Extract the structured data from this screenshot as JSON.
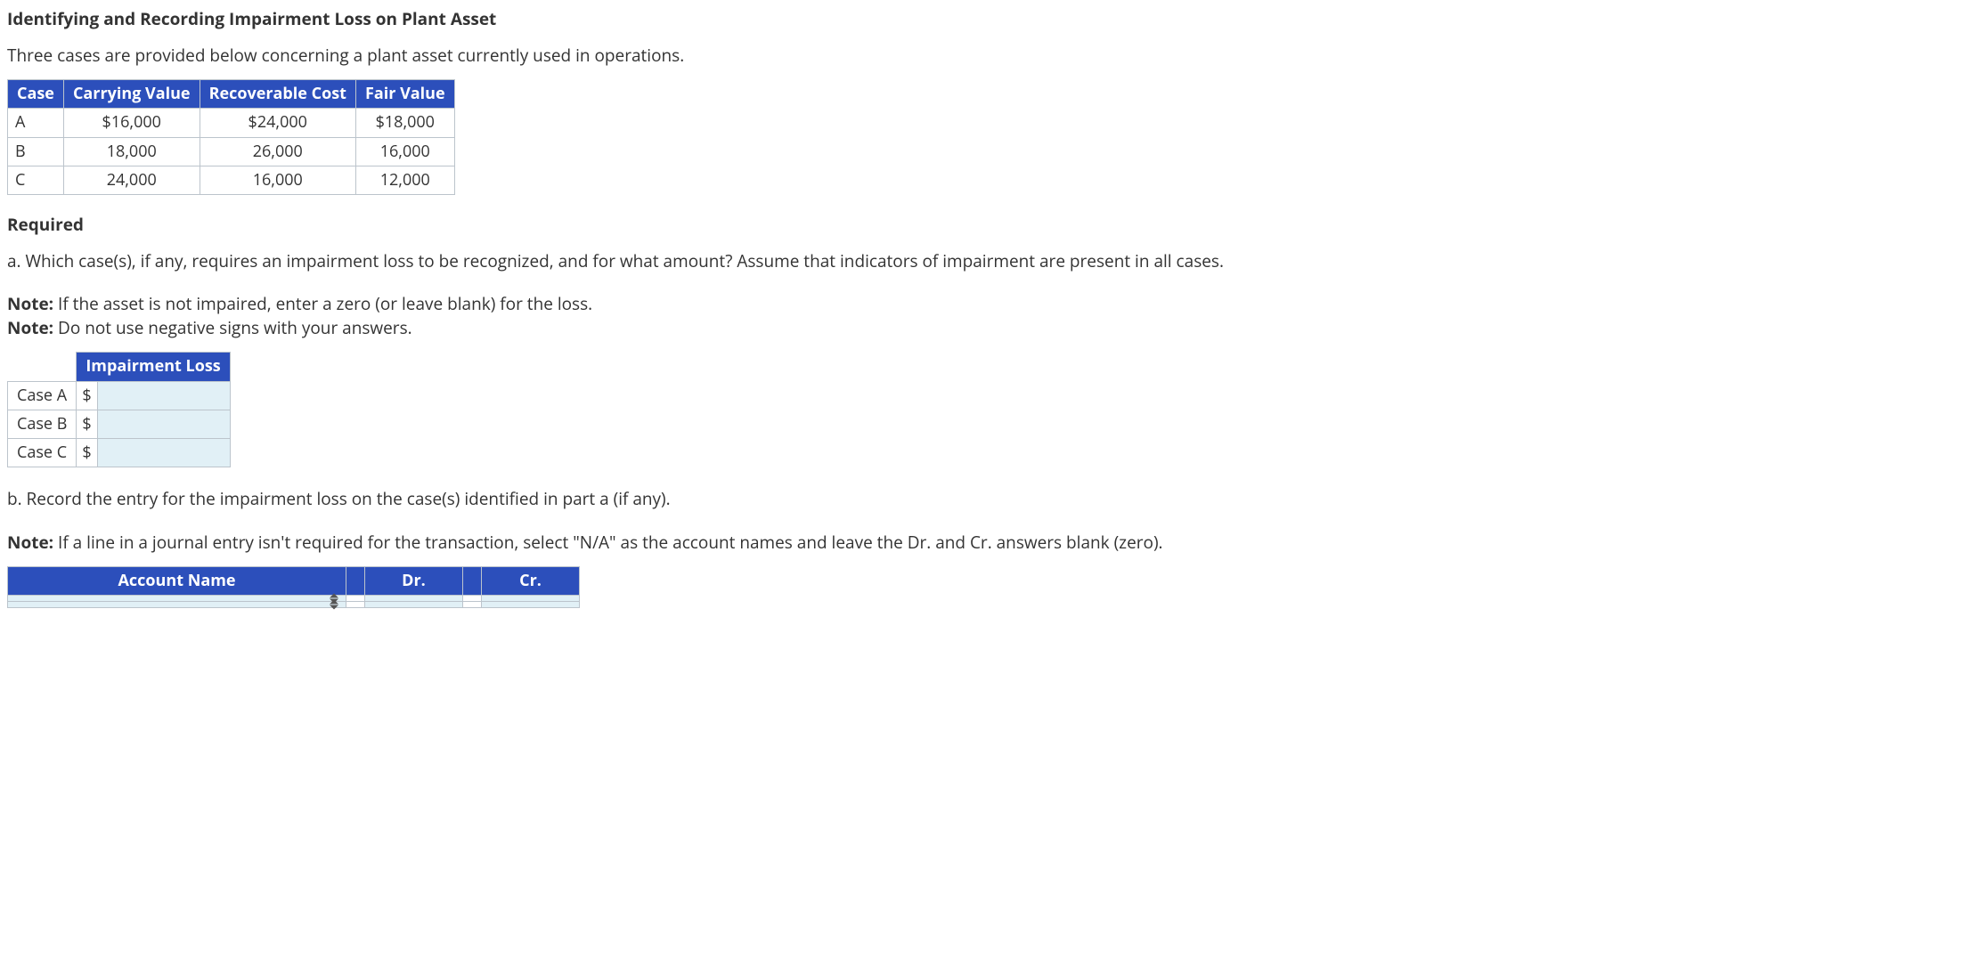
{
  "title": "Identifying and Recording Impairment Loss on Plant Asset",
  "intro": "Three cases are provided below concerning a plant asset currently used in operations.",
  "data_table": {
    "headers": [
      "Case",
      "Carrying Value",
      "Recoverable Cost",
      "Fair Value"
    ],
    "rows": [
      {
        "case": "A",
        "carrying": "$16,000",
        "recoverable": "$24,000",
        "fair": "$18,000"
      },
      {
        "case": "B",
        "carrying": "18,000",
        "recoverable": "26,000",
        "fair": "16,000"
      },
      {
        "case": "C",
        "carrying": "24,000",
        "recoverable": "16,000",
        "fair": "12,000"
      }
    ]
  },
  "required_label": "Required",
  "part_a": "a. Which case(s), if any, requires an impairment loss to be recognized, and for what amount? Assume that indicators of impairment are present in all cases.",
  "note1_label": "Note:",
  "note1": " If the asset is not impaired, enter a zero (or leave blank) for the loss.",
  "note2_label": "Note:",
  "note2": " Do not use negative signs with your answers.",
  "impair_table": {
    "header": "Impairment Loss",
    "rows": [
      {
        "label": "Case A",
        "prefix": "$"
      },
      {
        "label": "Case B",
        "prefix": "$"
      },
      {
        "label": "Case C",
        "prefix": "$"
      }
    ]
  },
  "part_b": "b. Record the entry for the impairment loss on the case(s) identified in part a (if any).",
  "note3_label": "Note:",
  "note3": " If a line in a journal entry isn't required for the transaction, select \"N/A\" as the account names and leave the Dr. and Cr. answers blank (zero).",
  "je_table": {
    "headers": [
      "Account Name",
      "Dr.",
      "Cr."
    ]
  }
}
